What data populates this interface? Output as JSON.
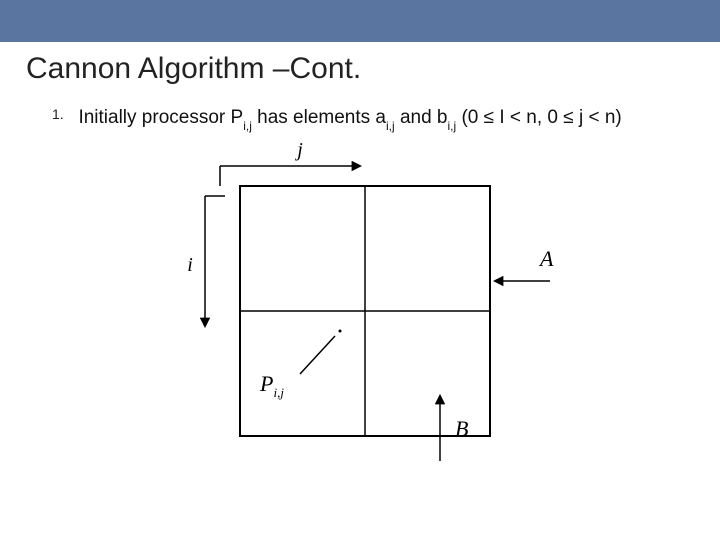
{
  "title": "Cannon Algorithm –Cont.",
  "list": {
    "number": "1.",
    "prefix": "Initially processor P",
    "sub1": "i,j",
    "mid1": " has elements a",
    "sub2": "i,j",
    "mid2": " and b",
    "sub3": "i,j",
    "tail": " (0 ≤ I < n, 0 ≤ j < n)"
  },
  "diagram": {
    "i": "i",
    "j": "j",
    "A": "A",
    "B": "B",
    "P": "P",
    "Psub": "i,j"
  }
}
